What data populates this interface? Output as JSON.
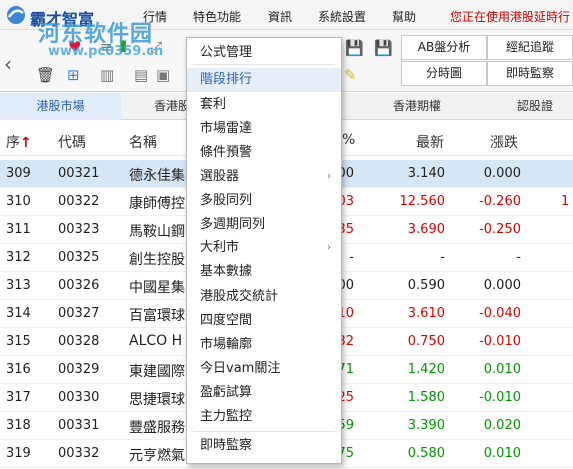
{
  "app": {
    "title": "霸才智富",
    "watermark_text": "河东软件园",
    "watermark_url": "www.pc0359.cn"
  },
  "menubar": {
    "items": [
      "行情",
      "特色功能",
      "資訊",
      "系統設置",
      "幫助"
    ],
    "status_marquee": "您正在使用港股延時行"
  },
  "toolbar": {
    "buttons": [
      "AB盤分析",
      "經紀追蹤",
      "分時圖",
      "即時監察"
    ]
  },
  "tabs": [
    "港股市場",
    "香港股",
    "香港期權",
    "認股證"
  ],
  "table": {
    "headers": [
      "序",
      "代碼",
      "名稱",
      "%",
      "最新",
      "漲跌"
    ],
    "sort_indicator": "↑",
    "rows": [
      {
        "seq": "309",
        "code": "00321",
        "name": "德永佳集",
        "pct": "00",
        "last": "3.140",
        "chg": "0.000",
        "dir": "flat",
        "x": ""
      },
      {
        "seq": "310",
        "code": "00322",
        "name": "康師傅控",
        "pct": "03",
        "last": "12.560",
        "chg": "-0.260",
        "dir": "up",
        "x": "1"
      },
      {
        "seq": "311",
        "code": "00323",
        "name": "馬鞍山鋼",
        "pct": "35",
        "last": "3.690",
        "chg": "-0.250",
        "dir": "up",
        "x": ""
      },
      {
        "seq": "312",
        "code": "00325",
        "name": "創生控股",
        "pct": "-",
        "last": "-",
        "chg": "-",
        "dir": "flat",
        "x": ""
      },
      {
        "seq": "313",
        "code": "00326",
        "name": "中國星集",
        "pct": "00",
        "last": "0.590",
        "chg": "0.000",
        "dir": "flat",
        "x": ""
      },
      {
        "seq": "314",
        "code": "00327",
        "name": "百富環球",
        "pct": "10",
        "last": "3.610",
        "chg": "-0.040",
        "dir": "up",
        "x": ""
      },
      {
        "seq": "315",
        "code": "00328",
        "name": "ALCO H",
        "pct": "32",
        "last": "0.750",
        "chg": "-0.010",
        "dir": "up",
        "x": ""
      },
      {
        "seq": "316",
        "code": "00329",
        "name": "東建國際",
        "pct": "71",
        "last": "1.420",
        "chg": "0.010",
        "dir": "dn",
        "x": ""
      },
      {
        "seq": "317",
        "code": "00330",
        "name": "思捷環球",
        "pct": "25",
        "last": "1.580",
        "chg": "-0.010",
        "dir": "mixed",
        "x": ""
      },
      {
        "seq": "318",
        "code": "00331",
        "name": "豐盛服務",
        "pct": "59",
        "last": "3.390",
        "chg": "0.020",
        "dir": "dn",
        "x": ""
      },
      {
        "seq": "319",
        "code": "00332",
        "name": "元亨燃氣",
        "pct": "75",
        "last": "0.580",
        "chg": "0.010",
        "dir": "dn",
        "x": ""
      }
    ]
  },
  "dropdown": {
    "items": [
      {
        "label": "公式管理",
        "submenu": false
      },
      {
        "label": "階段排行",
        "submenu": false,
        "hover": true
      },
      {
        "label": "套利",
        "submenu": false
      },
      {
        "label": "市場雷達",
        "submenu": false
      },
      {
        "label": "條件預警",
        "submenu": false
      },
      {
        "label": "選股器",
        "submenu": true
      },
      {
        "label": "多股同列",
        "submenu": false
      },
      {
        "label": "多週期同列",
        "submenu": false
      },
      {
        "label": "大利市",
        "submenu": true
      },
      {
        "label": "基本數據",
        "submenu": false
      },
      {
        "label": "港股成交統計",
        "submenu": false
      },
      {
        "label": "四度空間",
        "submenu": false
      },
      {
        "label": "市場輪廓",
        "submenu": false
      },
      {
        "label": "今日vam關注",
        "submenu": false
      },
      {
        "label": "盈虧試算",
        "submenu": false
      },
      {
        "label": "主力監控",
        "submenu": false
      },
      {
        "label": "即時監察",
        "submenu": false
      }
    ]
  },
  "colors": {
    "up": "#e00000",
    "down": "#009900",
    "accent": "#2a64b0",
    "selected_row": "#d5e6f7"
  }
}
